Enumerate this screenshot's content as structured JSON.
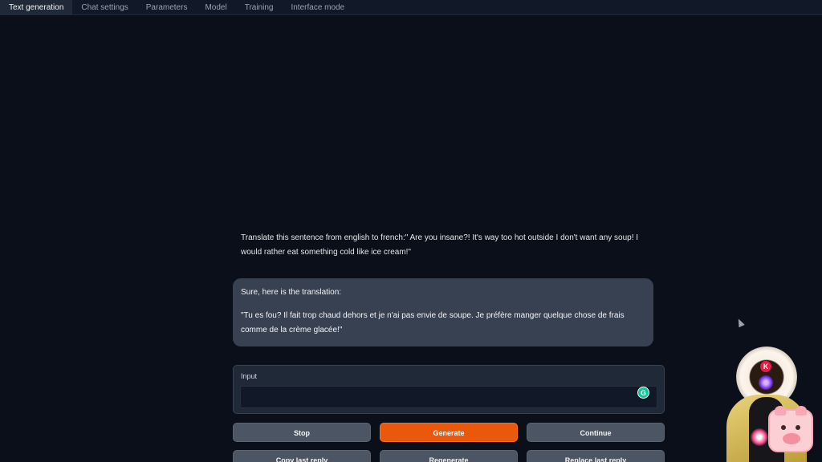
{
  "tabs": [
    "Text generation",
    "Chat settings",
    "Parameters",
    "Model",
    "Training",
    "Interface mode"
  ],
  "chat": {
    "user_message": "Translate this sentence from english to french:\" Are you insane?! It's way too hot outside I don't want any soup! I would rather eat something cold like ice cream!\"",
    "bot_intro": "Sure, here is the translation:",
    "bot_translation": "\"Tu es fou? Il fait trop chaud dehors et je n'ai pas envie de soupe. Je préfère manger quelque chose de frais comme de la crème glacée!\""
  },
  "input": {
    "label": "Input",
    "value": "",
    "grammarly_icon": "G"
  },
  "buttons": {
    "stop": "Stop",
    "generate": "Generate",
    "continue": "Continue",
    "copy_last_reply": "Copy last reply",
    "regenerate": "Regenerate",
    "replace_last_reply": "Replace last reply"
  },
  "avatar": {
    "badge_letter": "K"
  },
  "colors": {
    "background": "#0b0f19",
    "primary_button": "#ea580c",
    "secondary_button": "#4b5563",
    "bot_bubble": "#374151"
  }
}
